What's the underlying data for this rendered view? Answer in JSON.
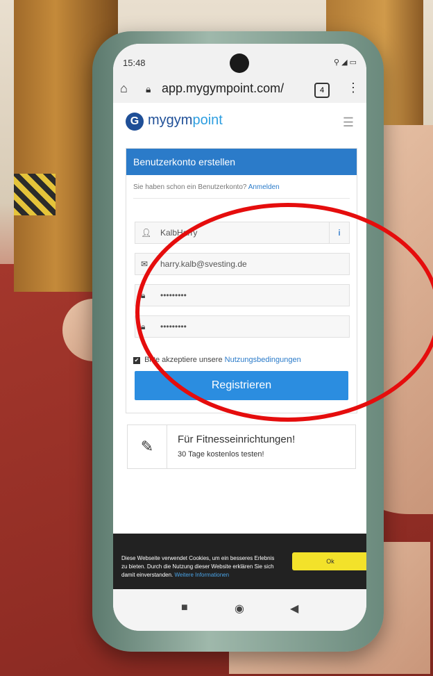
{
  "statusbar": {
    "time": "15:48",
    "icons": "⚲ ◢ ▭"
  },
  "browser": {
    "url": "app.mygympoint.com/",
    "tab_count": "4"
  },
  "app": {
    "logo_part1": "mygym",
    "logo_part2": "point"
  },
  "signup": {
    "title": "Benutzerkonto erstellen",
    "prompt": "Sie haben schon ein Benutzerkonto?",
    "login_link": "Anmelden",
    "username": "KalbHarry",
    "email": "harry.kalb@svesting.de",
    "password": "•••••••••",
    "password_repeat": "•••••••••",
    "accept_text": "Bitte akzeptiere unsere",
    "terms_link": "Nutzungsbedingungen",
    "register_label": "Registrieren"
  },
  "promo": {
    "title": "Für Fitnesseinrichtungen!",
    "subtitle": "30 Tage kostenlos testen!"
  },
  "cookie": {
    "text": "Diese Webseite verwendet Cookies, um ein besseres Erlebnis zu bieten. Durch die Nutzung dieser Website erklären Sie sich damit einverstanden.",
    "link": "Weitere Informationen",
    "ok_label": "Ok"
  }
}
